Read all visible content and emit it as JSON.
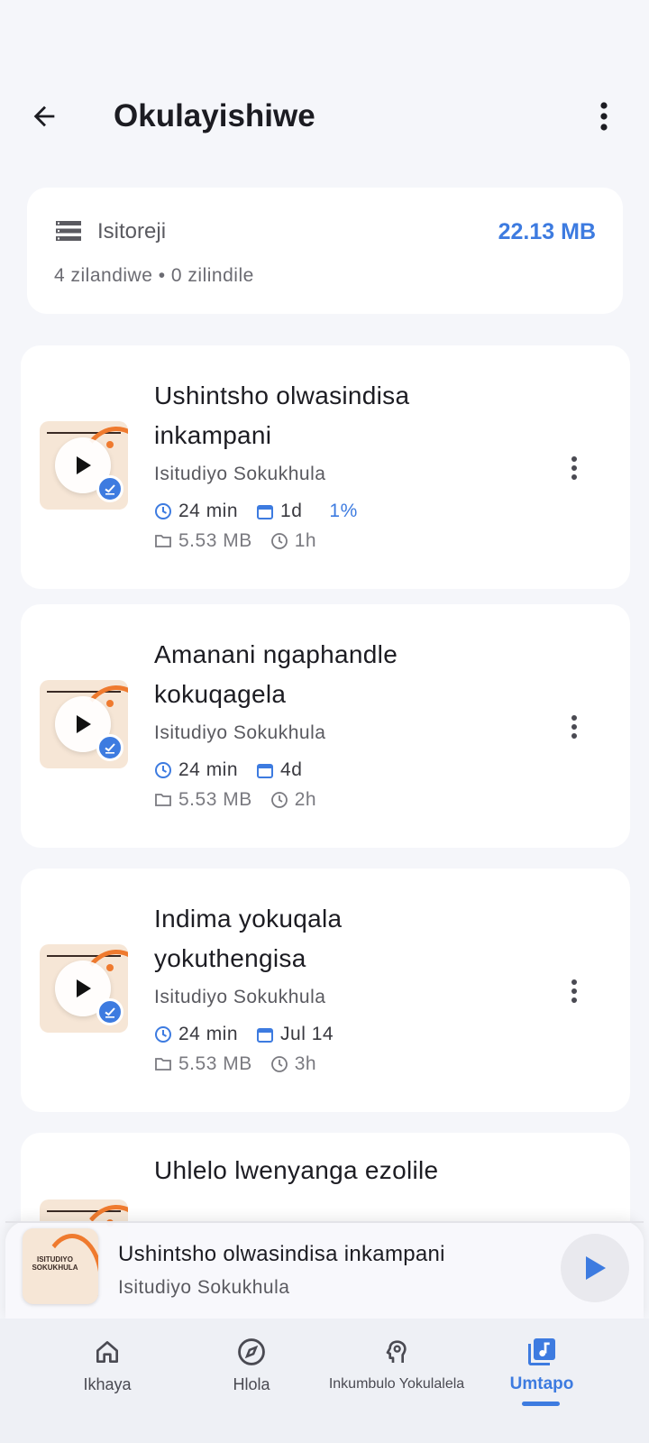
{
  "header": {
    "title": "Okulayishiwe"
  },
  "storage": {
    "label": "Isitoreji",
    "total": "22.13 MB",
    "summary": "4 zilandiwe • 0 zilindile"
  },
  "episodes": [
    {
      "title": "Ushintsho olwasindisa inkampani",
      "author": "Isitudiyo Sokukhula",
      "duration": "24 min",
      "age": "1d",
      "progress": "1%",
      "size": "5.53 MB",
      "time_ago": "1h"
    },
    {
      "title": "Amanani ngaphandle kokuqagela",
      "author": "Isitudiyo Sokukhula",
      "duration": "24 min",
      "age": "4d",
      "size": "5.53 MB",
      "time_ago": "2h"
    },
    {
      "title": "Indima yokuqala yokuthengisa",
      "author": "Isitudiyo Sokukhula",
      "duration": "24 min",
      "age": "Jul 14",
      "size": "5.53 MB",
      "time_ago": "3h"
    },
    {
      "title": "Uhlelo lwenyanga ezolile"
    }
  ],
  "mini_player": {
    "title": "Ushintsho olwasindisa inkampani",
    "author": "Isitudiyo Sokukhula",
    "art_text": "ISITUDIYO SOKUKHULA"
  },
  "nav": {
    "items": [
      {
        "label": "Ikhaya",
        "icon": "home-icon"
      },
      {
        "label": "Hlola",
        "icon": "compass-icon"
      },
      {
        "label": "Inkumbulo Yokulalela",
        "icon": "brain-icon"
      },
      {
        "label": "Umtapo",
        "icon": "library-music-icon"
      }
    ],
    "active": "Umtapo"
  },
  "colors": {
    "accent": "#3d7be0",
    "background": "#f5f6fa",
    "thumb_bg": "#f6e6d6",
    "thumb_arc": "#ef7a2e"
  }
}
